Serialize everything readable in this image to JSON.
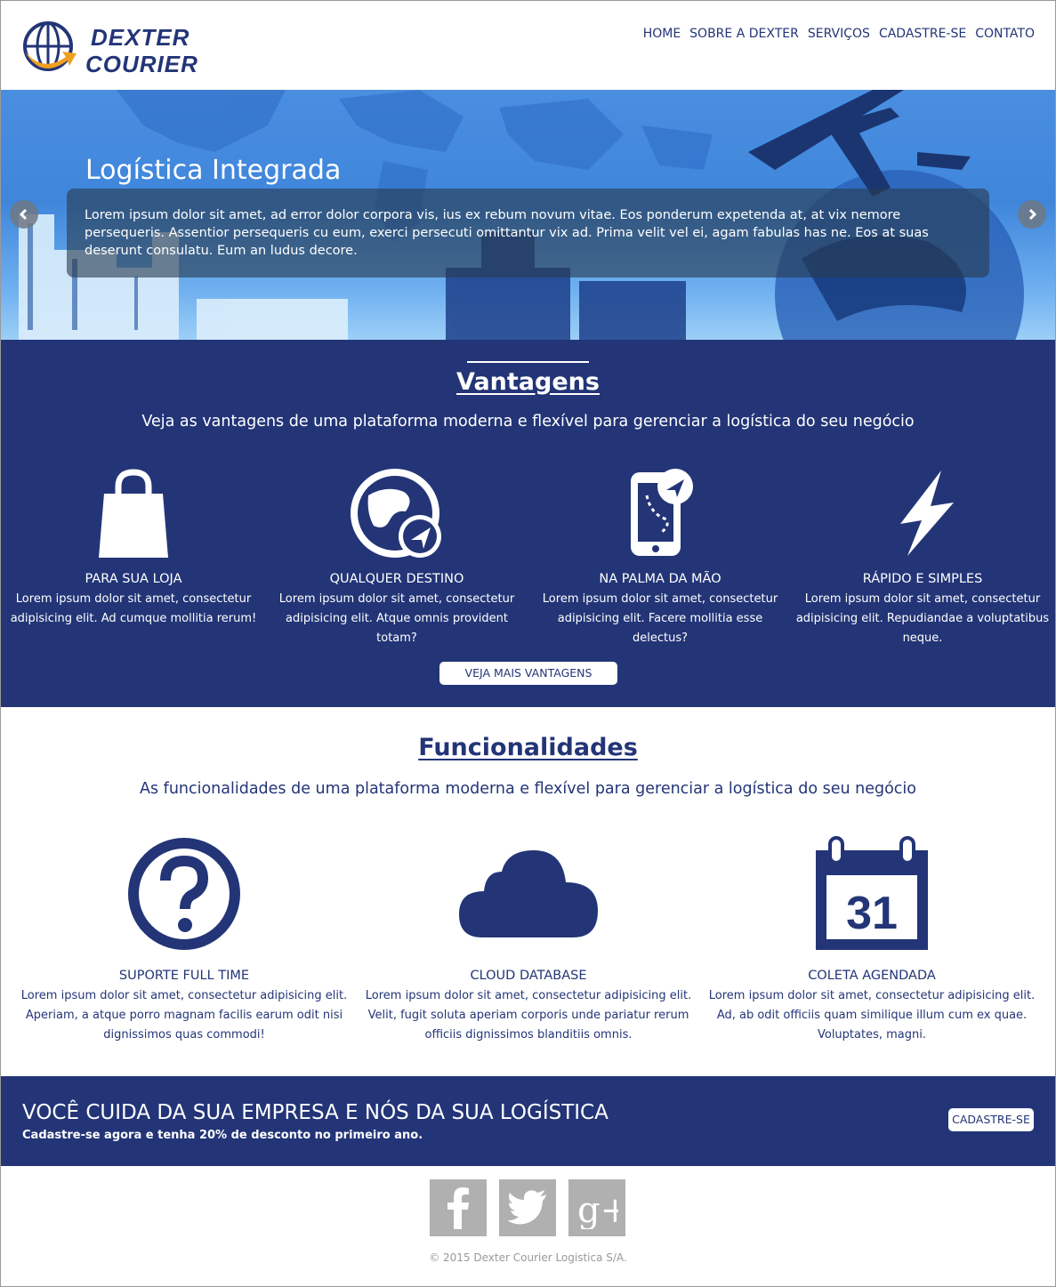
{
  "brand": {
    "line1": "DEXTER",
    "line2": "COURIER"
  },
  "nav": [
    {
      "label": "HOME"
    },
    {
      "label": "SOBRE A DEXTER"
    },
    {
      "label": "SERVIÇOS"
    },
    {
      "label": "CADASTRE-SE"
    },
    {
      "label": "CONTATO"
    }
  ],
  "hero": {
    "title": "Logística Integrada",
    "text": "Lorem ipsum dolor sit amet, ad error dolor corpora vis, ius ex rebum novum vitae. Eos ponderum expetenda at, at vix nemore persequeris. Assentior persequeris cu eum, exerci persecuti omittantur vix ad. Prima velit vel ei, agam fabulas has ne. Eos at suas deserunt consulatu. Eum an ludus decore.",
    "prev_icon": "chevron-left-icon",
    "next_icon": "chevron-right-icon"
  },
  "vantagens": {
    "title": "Vantagens",
    "subtitle": "Veja as vantagens de uma plataforma moderna e flexível para gerenciar a logística do seu negócio",
    "items": [
      {
        "icon": "shopping-bag-icon",
        "title": "PARA SUA LOJA",
        "text": "Lorem ipsum dolor sit amet, consectetur adipisicing elit. Ad cumque mollitia rerum!"
      },
      {
        "icon": "globe-navigation-icon",
        "title": "QUALQUER DESTINO",
        "text": "Lorem ipsum dolor sit amet, consectetur adipisicing elit. Atque omnis provident totam?"
      },
      {
        "icon": "phone-route-icon",
        "title": "NA PALMA DA MÃO",
        "text": "Lorem ipsum dolor sit amet, consectetur adipisicing elit. Facere mollitia esse delectus?"
      },
      {
        "icon": "lightning-icon",
        "title": "RÁPIDO E SIMPLES",
        "text": "Lorem ipsum dolor sit amet, consectetur adipisicing elit. Repudiandae a voluptatibus neque."
      }
    ],
    "button": "VEJA MAIS VANTAGENS"
  },
  "funcionalidades": {
    "title": "Funcionalidades",
    "subtitle": "As funcionalidades de uma plataforma moderna e flexível para gerenciar a logística do seu negócio",
    "items": [
      {
        "icon": "question-circle-icon",
        "title": "SUPORTE FULL TIME",
        "text": "Lorem ipsum dolor sit amet, consectetur adipisicing elit. Aperiam, a atque porro magnam facilis earum odit nisi dignissimos quas commodi!"
      },
      {
        "icon": "cloud-icon",
        "title": "CLOUD DATABASE",
        "text": "Lorem ipsum dolor sit amet, consectetur adipisicing elit. Velit, fugit soluta aperiam corporis unde pariatur rerum officiis dignissimos blanditiis omnis."
      },
      {
        "icon": "calendar-icon",
        "title": "COLETA AGENDADA",
        "text": "Lorem ipsum dolor sit amet, consectetur adipisicing elit. Ad, ab odit officiis quam similique illum cum ex quae. Voluptates, magni.",
        "calendar_day": "31"
      }
    ]
  },
  "cta": {
    "headline": "VOCÊ CUIDA DA SUA EMPRESA E NÓS DA SUA LOGÍSTICA",
    "subtext": "Cadastre-se agora e tenha 20% de desconto no primeiro ano.",
    "button": "CADASTRE-SE"
  },
  "footer": {
    "social": [
      {
        "icon": "facebook-icon"
      },
      {
        "icon": "twitter-icon"
      },
      {
        "icon": "google-plus-icon",
        "label": "g+"
      }
    ],
    "copyright": "© 2015 Dexter Courier Logistica S/A."
  },
  "colors": {
    "primary": "#233577",
    "accent": "#f0a020",
    "hero_blue": "#3f86db",
    "social_gray": "#b0b0b0"
  }
}
